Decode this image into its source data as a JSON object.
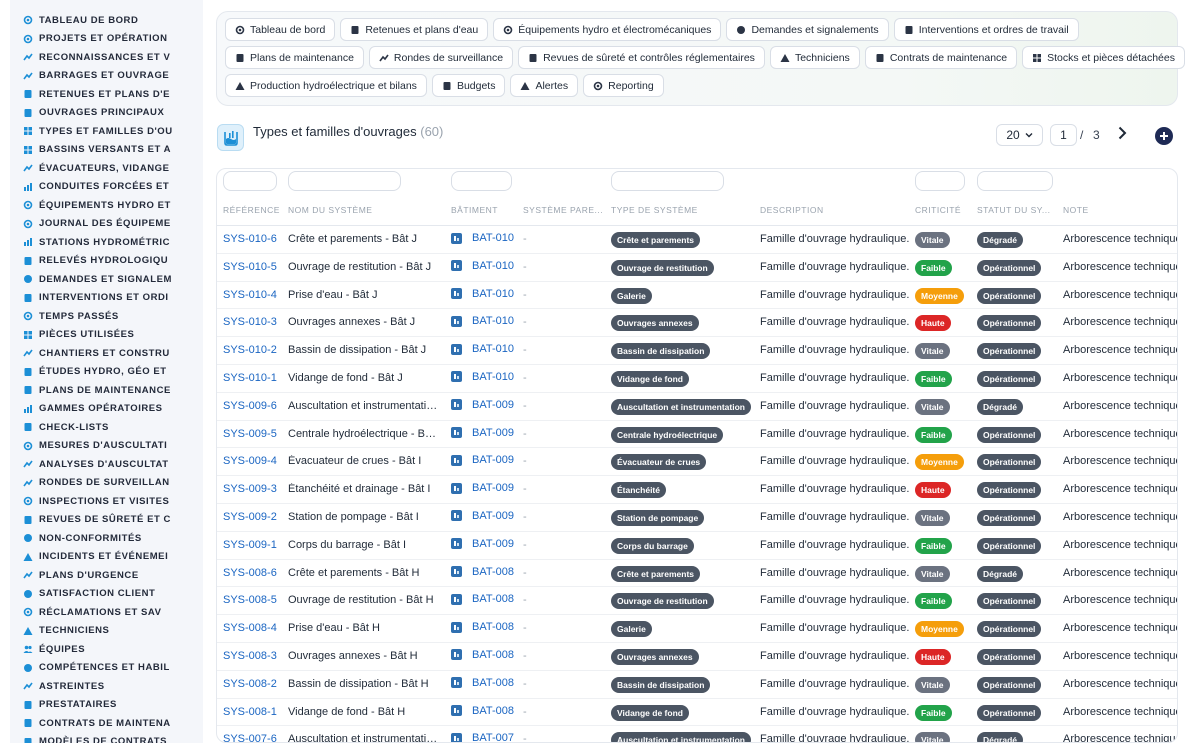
{
  "sidebar": {
    "items": [
      {
        "label": "TABLEAU DE BORD",
        "icon": "dashboard-icon"
      },
      {
        "label": "PROJETS ET OPÉRATION",
        "icon": "target-icon"
      },
      {
        "label": "RECONNAISSANCES ET V",
        "icon": "clipboard-icon"
      },
      {
        "label": "BARRAGES ET OUVRAGE",
        "icon": "dam-icon"
      },
      {
        "label": "RETENUES ET PLANS D'E",
        "icon": "building-icon"
      },
      {
        "label": "OUVRAGES PRINCIPAUX",
        "icon": "document-icon"
      },
      {
        "label": "TYPES ET FAMILLES D'OU",
        "icon": "hierarchy-icon"
      },
      {
        "label": "BASSINS VERSANTS ET A",
        "icon": "grid-icon"
      },
      {
        "label": "ÉVACUATEURS, VIDANGE",
        "icon": "flow-icon"
      },
      {
        "label": "CONDUITES FORCÉES ET",
        "icon": "pipe-icon"
      },
      {
        "label": "ÉQUIPEMENTS HYDRO ET",
        "icon": "gears-icon"
      },
      {
        "label": "JOURNAL DES ÉQUIPEME",
        "icon": "history-icon"
      },
      {
        "label": "STATIONS HYDROMÉTRIC",
        "icon": "station-icon"
      },
      {
        "label": "RELEVÉS HYDROLOGIQU",
        "icon": "readings-icon"
      },
      {
        "label": "DEMANDES ET SIGNALEM",
        "icon": "question-icon"
      },
      {
        "label": "INTERVENTIONS ET ORDI",
        "icon": "clipboard-check-icon"
      },
      {
        "label": "TEMPS PASSÉS",
        "icon": "clock-icon"
      },
      {
        "label": "PIÈCES UTILISÉES",
        "icon": "boxes-icon"
      },
      {
        "label": "CHANTIERS ET CONSTRU",
        "icon": "hammer-icon"
      },
      {
        "label": "ÉTUDES HYDRO, GÉO ET",
        "icon": "magnifier-doc-icon"
      },
      {
        "label": "PLANS DE MAINTENANCE",
        "icon": "calendar-icon"
      },
      {
        "label": "GAMMES OPÉRATOIRES",
        "icon": "list-icon"
      },
      {
        "label": "CHECK-LISTS",
        "icon": "checklist-icon"
      },
      {
        "label": "MESURES D'AUSCULTATI",
        "icon": "gauge-icon"
      },
      {
        "label": "ANALYSES D'AUSCULTAT",
        "icon": "chart-icon"
      },
      {
        "label": "RONDES DE SURVEILLAN",
        "icon": "route-icon"
      },
      {
        "label": "INSPECTIONS ET VISITES",
        "icon": "search-icon"
      },
      {
        "label": "REVUES DE SÛRETÉ ET C",
        "icon": "file-check-icon"
      },
      {
        "label": "NON-CONFORMITÉS",
        "icon": "alert-circle-icon"
      },
      {
        "label": "INCIDENTS ET ÉVÉNEMEI",
        "icon": "warning-icon"
      },
      {
        "label": "PLANS D'URGENCE",
        "icon": "map-icon"
      },
      {
        "label": "SATISFACTION CLIENT",
        "icon": "smile-icon"
      },
      {
        "label": "RÉCLAMATIONS ET SAV",
        "icon": "headset-icon"
      },
      {
        "label": "TECHNICIENS",
        "icon": "hardhat-icon"
      },
      {
        "label": "ÉQUIPES",
        "icon": "users-icon"
      },
      {
        "label": "COMPÉTENCES ET HABIL",
        "icon": "badge-icon"
      },
      {
        "label": "ASTREINTES",
        "icon": "phone-icon"
      },
      {
        "label": "PRESTATAIRES",
        "icon": "truck-icon"
      },
      {
        "label": "CONTRATS DE MAINTENA",
        "icon": "contract-icon"
      },
      {
        "label": "MODÈLES DE CONTRATS",
        "icon": "template-icon"
      }
    ]
  },
  "nav": {
    "rows": [
      [
        {
          "label": "Tableau de bord",
          "icon": "dashboard-icon"
        },
        {
          "label": "Retenues et plans d'eau",
          "icon": "building-icon"
        },
        {
          "label": "Équipements hydro et électromécaniques",
          "icon": "gears-icon"
        },
        {
          "label": "Demandes et signalements",
          "icon": "question-icon"
        },
        {
          "label": "Interventions et ordres de travail",
          "icon": "clipboard-check-icon"
        }
      ],
      [
        {
          "label": "Plans de maintenance",
          "icon": "calendar-icon"
        },
        {
          "label": "Rondes de surveillance",
          "icon": "route-icon"
        },
        {
          "label": "Revues de sûreté et contrôles réglementaires",
          "icon": "file-check-icon"
        },
        {
          "label": "Techniciens",
          "icon": "hardhat-icon"
        },
        {
          "label": "Contrats de maintenance",
          "icon": "contract-icon"
        },
        {
          "label": "Stocks et pièces détachées",
          "icon": "boxes-icon"
        }
      ],
      [
        {
          "label": "Production hydroélectrique et bilans",
          "icon": "bolt-icon"
        },
        {
          "label": "Budgets",
          "icon": "money-icon"
        },
        {
          "label": "Alertes",
          "icon": "bell-icon"
        },
        {
          "label": "Reporting",
          "icon": "pie-icon"
        }
      ]
    ]
  },
  "header": {
    "title": "Types et familles d'ouvrages",
    "count": "(60)"
  },
  "pager": {
    "page_size": "20",
    "current_page": "1",
    "separator": "/",
    "total_pages": "3"
  },
  "table": {
    "columns": [
      "RÉFÉRENCE",
      "NOM DU SYSTÈME",
      "BÂTIMENT",
      "SYSTÈME PARE...",
      "TYPE DE SYSTÈME",
      "DESCRIPTION",
      "CRITICITÉ",
      "STATUT DU SY...",
      "NOTE"
    ],
    "rows": [
      {
        "ref": "SYS-010-6",
        "name": "Crête et parements - Bât J",
        "bat": "BAT-010",
        "parent": "-",
        "type": "Crête et parements",
        "desc": "Famille d'ouvrage hydraulique.",
        "crit": "Vitale",
        "status": "Dégradé",
        "note": "Arborescence technique"
      },
      {
        "ref": "SYS-010-5",
        "name": "Ouvrage de restitution - Bât J",
        "bat": "BAT-010",
        "parent": "-",
        "type": "Ouvrage de restitution",
        "desc": "Famille d'ouvrage hydraulique.",
        "crit": "Faible",
        "status": "Opérationnel",
        "note": "Arborescence technique"
      },
      {
        "ref": "SYS-010-4",
        "name": "Prise d'eau - Bât J",
        "bat": "BAT-010",
        "parent": "-",
        "type": "Galerie",
        "desc": "Famille d'ouvrage hydraulique.",
        "crit": "Moyenne",
        "status": "Opérationnel",
        "note": "Arborescence technique"
      },
      {
        "ref": "SYS-010-3",
        "name": "Ouvrages annexes - Bât J",
        "bat": "BAT-010",
        "parent": "-",
        "type": "Ouvrages annexes",
        "desc": "Famille d'ouvrage hydraulique.",
        "crit": "Haute",
        "status": "Opérationnel",
        "note": "Arborescence technique"
      },
      {
        "ref": "SYS-010-2",
        "name": "Bassin de dissipation - Bât J",
        "bat": "BAT-010",
        "parent": "-",
        "type": "Bassin de dissipation",
        "desc": "Famille d'ouvrage hydraulique.",
        "crit": "Vitale",
        "status": "Opérationnel",
        "note": "Arborescence technique"
      },
      {
        "ref": "SYS-010-1",
        "name": "Vidange de fond - Bât J",
        "bat": "BAT-010",
        "parent": "-",
        "type": "Vidange de fond",
        "desc": "Famille d'ouvrage hydraulique.",
        "crit": "Faible",
        "status": "Opérationnel",
        "note": "Arborescence technique"
      },
      {
        "ref": "SYS-009-6",
        "name": "Auscultation et instrumentation - Bât I",
        "bat": "BAT-009",
        "parent": "-",
        "type": "Auscultation et instrumentation",
        "desc": "Famille d'ouvrage hydraulique.",
        "crit": "Vitale",
        "status": "Dégradé",
        "note": "Arborescence technique"
      },
      {
        "ref": "SYS-009-5",
        "name": "Centrale hydroélectrique - Bât I",
        "bat": "BAT-009",
        "parent": "-",
        "type": "Centrale hydroélectrique",
        "desc": "Famille d'ouvrage hydraulique.",
        "crit": "Faible",
        "status": "Opérationnel",
        "note": "Arborescence technique"
      },
      {
        "ref": "SYS-009-4",
        "name": "Évacuateur de crues - Bât I",
        "bat": "BAT-009",
        "parent": "-",
        "type": "Évacuateur de crues",
        "desc": "Famille d'ouvrage hydraulique.",
        "crit": "Moyenne",
        "status": "Opérationnel",
        "note": "Arborescence technique"
      },
      {
        "ref": "SYS-009-3",
        "name": "Étanchéité et drainage - Bât I",
        "bat": "BAT-009",
        "parent": "-",
        "type": "Étanchéité",
        "desc": "Famille d'ouvrage hydraulique.",
        "crit": "Haute",
        "status": "Opérationnel",
        "note": "Arborescence technique"
      },
      {
        "ref": "SYS-009-2",
        "name": "Station de pompage - Bât I",
        "bat": "BAT-009",
        "parent": "-",
        "type": "Station de pompage",
        "desc": "Famille d'ouvrage hydraulique.",
        "crit": "Vitale",
        "status": "Opérationnel",
        "note": "Arborescence technique"
      },
      {
        "ref": "SYS-009-1",
        "name": "Corps du barrage - Bât I",
        "bat": "BAT-009",
        "parent": "-",
        "type": "Corps du barrage",
        "desc": "Famille d'ouvrage hydraulique.",
        "crit": "Faible",
        "status": "Opérationnel",
        "note": "Arborescence technique"
      },
      {
        "ref": "SYS-008-6",
        "name": "Crête et parements - Bât H",
        "bat": "BAT-008",
        "parent": "-",
        "type": "Crête et parements",
        "desc": "Famille d'ouvrage hydraulique.",
        "crit": "Vitale",
        "status": "Dégradé",
        "note": "Arborescence technique"
      },
      {
        "ref": "SYS-008-5",
        "name": "Ouvrage de restitution - Bât H",
        "bat": "BAT-008",
        "parent": "-",
        "type": "Ouvrage de restitution",
        "desc": "Famille d'ouvrage hydraulique.",
        "crit": "Faible",
        "status": "Opérationnel",
        "note": "Arborescence technique"
      },
      {
        "ref": "SYS-008-4",
        "name": "Prise d'eau - Bât H",
        "bat": "BAT-008",
        "parent": "-",
        "type": "Galerie",
        "desc": "Famille d'ouvrage hydraulique.",
        "crit": "Moyenne",
        "status": "Opérationnel",
        "note": "Arborescence technique"
      },
      {
        "ref": "SYS-008-3",
        "name": "Ouvrages annexes - Bât H",
        "bat": "BAT-008",
        "parent": "-",
        "type": "Ouvrages annexes",
        "desc": "Famille d'ouvrage hydraulique.",
        "crit": "Haute",
        "status": "Opérationnel",
        "note": "Arborescence technique"
      },
      {
        "ref": "SYS-008-2",
        "name": "Bassin de dissipation - Bât H",
        "bat": "BAT-008",
        "parent": "-",
        "type": "Bassin de dissipation",
        "desc": "Famille d'ouvrage hydraulique.",
        "crit": "Vitale",
        "status": "Opérationnel",
        "note": "Arborescence technique"
      },
      {
        "ref": "SYS-008-1",
        "name": "Vidange de fond - Bât H",
        "bat": "BAT-008",
        "parent": "-",
        "type": "Vidange de fond",
        "desc": "Famille d'ouvrage hydraulique.",
        "crit": "Faible",
        "status": "Opérationnel",
        "note": "Arborescence technique"
      },
      {
        "ref": "SYS-007-6",
        "name": "Auscultation et instrumentation - Bât G",
        "bat": "BAT-007",
        "parent": "-",
        "type": "Auscultation et instrumentation",
        "desc": "Famille d'ouvrage hydraulique.",
        "crit": "Vitale",
        "status": "Dégradé",
        "note": "Arborescence technique"
      }
    ]
  },
  "colors": {
    "link": "#1a65c2",
    "sidebar_icon": "#1c8fd6",
    "pill_dark": "#4b5563",
    "vitale": "#6b7280",
    "faible": "#22a34a",
    "moyenne": "#f59e0b",
    "haute": "#dc2626",
    "add_button": "#1e2a55"
  }
}
